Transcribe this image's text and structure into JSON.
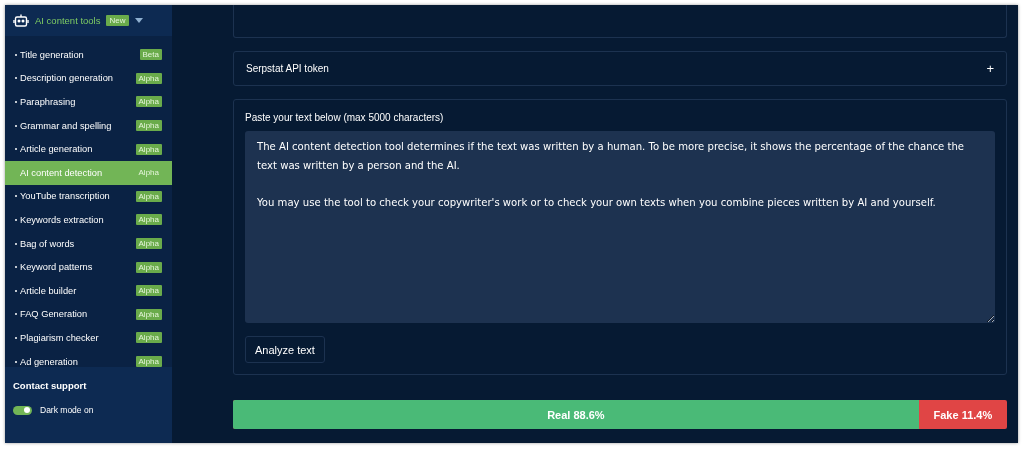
{
  "sidebar": {
    "header": {
      "title": "AI content tools",
      "badge": "New"
    },
    "items": [
      {
        "label": "Title generation",
        "badge": "Beta",
        "selected": false
      },
      {
        "label": "Description generation",
        "badge": "Alpha",
        "selected": false
      },
      {
        "label": "Paraphrasing",
        "badge": "Alpha",
        "selected": false
      },
      {
        "label": "Grammar and spelling",
        "badge": "Alpha",
        "selected": false
      },
      {
        "label": "Article generation",
        "badge": "Alpha",
        "selected": false
      },
      {
        "label": "AI content detection",
        "badge": "Alpha",
        "selected": true
      },
      {
        "label": "YouTube transcription",
        "badge": "Alpha",
        "selected": false
      },
      {
        "label": "Keywords extraction",
        "badge": "Alpha",
        "selected": false
      },
      {
        "label": "Bag of words",
        "badge": "Alpha",
        "selected": false
      },
      {
        "label": "Keyword patterns",
        "badge": "Alpha",
        "selected": false
      },
      {
        "label": "Article builder",
        "badge": "Alpha",
        "selected": false
      },
      {
        "label": "FAQ Generation",
        "badge": "Alpha",
        "selected": false
      },
      {
        "label": "Plagiarism checker",
        "badge": "Alpha",
        "selected": false
      },
      {
        "label": "Ad generation",
        "badge": "Alpha",
        "selected": false
      }
    ],
    "footer": {
      "contact": "Contact support",
      "dark_mode": {
        "label": "Dark mode on",
        "on": true
      }
    }
  },
  "token_panel": {
    "title": "Serpstat API token",
    "expand": "+"
  },
  "text_panel": {
    "label": "Paste your text below (max 5000 characters)",
    "value": "The AI content detection tool determines if the text was written by a human. To be more precise, it shows the percentage of the chance the text was written by a person and the AI.\n\nYou may use the tool to check your copywriter's work or to check your own texts when you combine pieces written by AI and yourself.",
    "button": "Analyze text"
  },
  "result": {
    "real_label": "Real 88.6%",
    "fake_label": "Fake 11.4%",
    "level": 0.886
  }
}
